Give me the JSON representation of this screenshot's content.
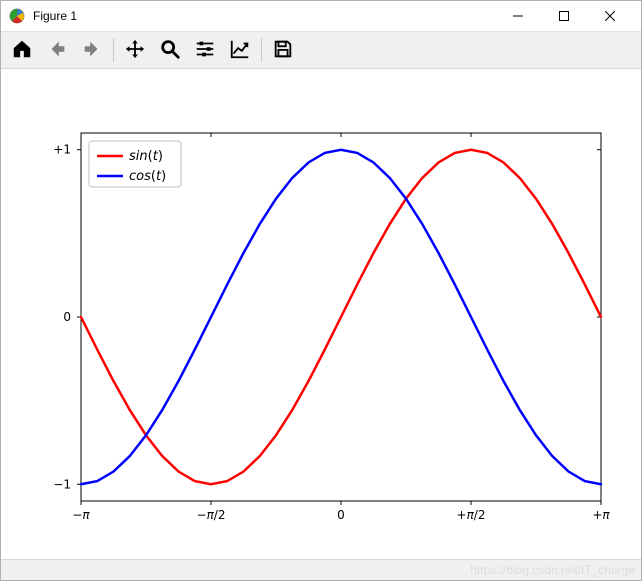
{
  "window": {
    "title": "Figure 1"
  },
  "toolbar": {
    "home": "Home",
    "back": "Back",
    "forward": "Forward",
    "pan": "Pan",
    "zoom": "Zoom",
    "subplots": "Configure subplots",
    "axes": "Edit axis",
    "save": "Save"
  },
  "watermark": "https://blog.csdn.net/IT_charge",
  "chart_data": {
    "type": "line",
    "xlabel": "",
    "ylabel": "",
    "xlim": [
      -3.14159,
      3.14159
    ],
    "ylim": [
      -1.1,
      1.1
    ],
    "grid": false,
    "legend_position": "upper-left",
    "x_ticks": [
      {
        "value": -3.14159,
        "label": "−π"
      },
      {
        "value": -1.570795,
        "label": "−π/2"
      },
      {
        "value": 0,
        "label": "0"
      },
      {
        "value": 1.570795,
        "label": "+π/2"
      },
      {
        "value": 3.14159,
        "label": "+π"
      }
    ],
    "y_ticks": [
      {
        "value": -1,
        "label": "−1"
      },
      {
        "value": 0,
        "label": "0"
      },
      {
        "value": 1,
        "label": "+1"
      }
    ],
    "series": [
      {
        "name": "sin(t)",
        "color": "#ff0000",
        "x": [
          -3.14159,
          -2.9452,
          -2.7489,
          -2.5525,
          -2.3562,
          -2.1598,
          -1.9635,
          -1.7671,
          -1.5708,
          -1.3744,
          -1.1781,
          -0.9817,
          -0.7854,
          -0.589,
          -0.3927,
          -0.1963,
          0,
          0.1963,
          0.3927,
          0.589,
          0.7854,
          0.9817,
          1.1781,
          1.3744,
          1.5708,
          1.7671,
          1.9635,
          2.1598,
          2.3562,
          2.5525,
          2.7489,
          2.9452,
          3.14159
        ],
        "y": [
          0,
          -0.1951,
          -0.3827,
          -0.5556,
          -0.7071,
          -0.8315,
          -0.9239,
          -0.9808,
          -1,
          -0.9808,
          -0.9239,
          -0.8315,
          -0.7071,
          -0.5556,
          -0.3827,
          -0.1951,
          0,
          0.1951,
          0.3827,
          0.5556,
          0.7071,
          0.8315,
          0.9239,
          0.9808,
          1,
          0.9808,
          0.9239,
          0.8315,
          0.7071,
          0.5556,
          0.3827,
          0.1951,
          0
        ]
      },
      {
        "name": "cos(t)",
        "color": "#0000ff",
        "x": [
          -3.14159,
          -2.9452,
          -2.7489,
          -2.5525,
          -2.3562,
          -2.1598,
          -1.9635,
          -1.7671,
          -1.5708,
          -1.3744,
          -1.1781,
          -0.9817,
          -0.7854,
          -0.589,
          -0.3927,
          -0.1963,
          0,
          0.1963,
          0.3927,
          0.589,
          0.7854,
          0.9817,
          1.1781,
          1.3744,
          1.5708,
          1.7671,
          1.9635,
          2.1598,
          2.3562,
          2.5525,
          2.7489,
          2.9452,
          3.14159
        ],
        "y": [
          -1,
          -0.9808,
          -0.9239,
          -0.8315,
          -0.7071,
          -0.5556,
          -0.3827,
          -0.1951,
          0,
          0.1951,
          0.3827,
          0.5556,
          0.7071,
          0.8315,
          0.9239,
          0.9808,
          1,
          0.9808,
          0.9239,
          0.8315,
          0.7071,
          0.5556,
          0.3827,
          0.1951,
          0,
          -0.1951,
          -0.3827,
          -0.5556,
          -0.7071,
          -0.8315,
          -0.9239,
          -0.9808,
          -1
        ]
      }
    ]
  }
}
